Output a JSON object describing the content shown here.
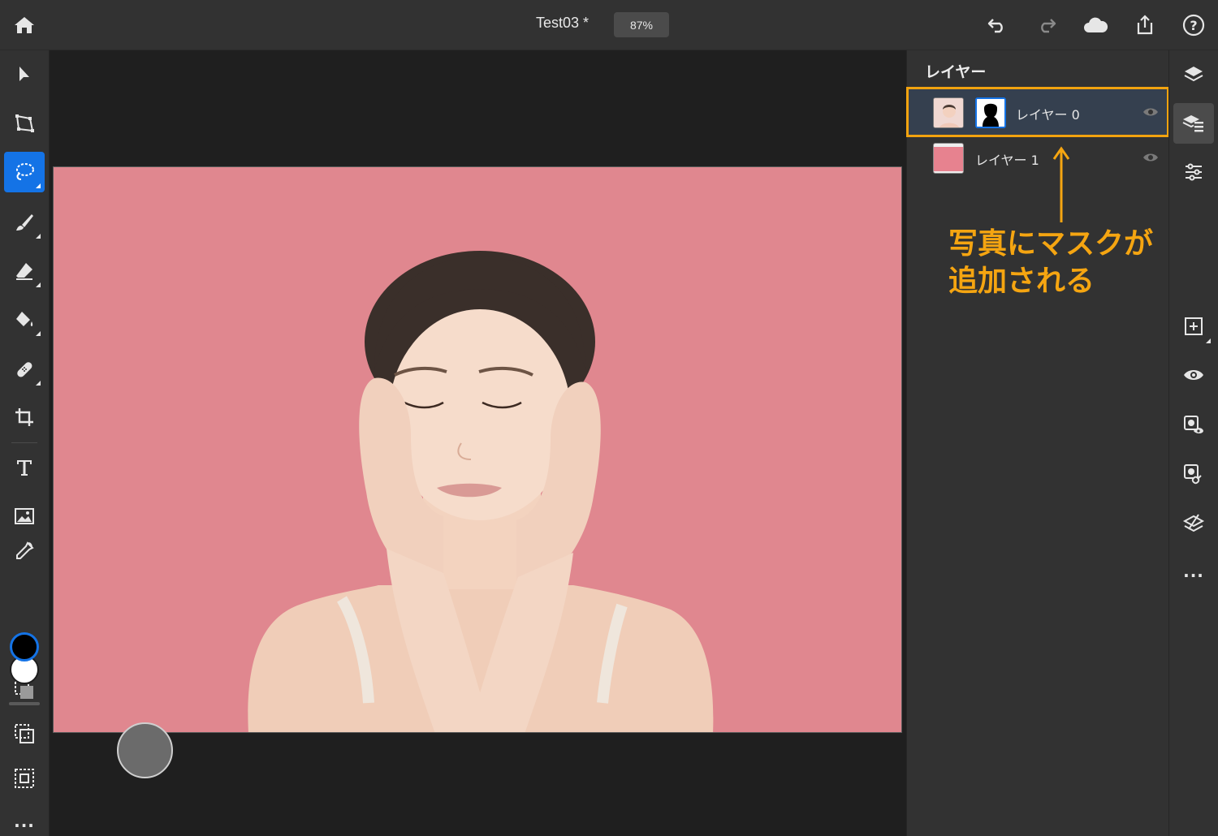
{
  "topbar": {
    "document_title": "Test03 *",
    "zoom": "87%",
    "left_icon": "home-icon",
    "right_icons": [
      "undo-icon",
      "redo-icon",
      "cloud-icon",
      "share-icon",
      "help-icon"
    ]
  },
  "left_toolbar": {
    "tools": [
      {
        "name": "select-tool",
        "icon": "arrow-pointer-icon"
      },
      {
        "name": "transform-tool",
        "icon": "transform-icon"
      },
      {
        "name": "lasso-tool",
        "icon": "lasso-icon",
        "active": true
      },
      {
        "name": "brush-tool",
        "icon": "brush-icon"
      },
      {
        "name": "eraser-tool",
        "icon": "eraser-icon"
      },
      {
        "name": "fill-tool",
        "icon": "paint-bucket-icon"
      },
      {
        "name": "healing-tool",
        "icon": "bandage-icon"
      },
      {
        "name": "crop-tool",
        "icon": "crop-icon"
      },
      {
        "name": "type-tool",
        "icon": "type-icon"
      },
      {
        "name": "place-image-tool",
        "icon": "image-icon"
      },
      {
        "name": "eyedropper-tool",
        "icon": "eyedropper-icon"
      }
    ],
    "foreground_color": "#000000",
    "background_color": "#ffffff",
    "selection_tools": [
      "select-subject-icon",
      "invert-selection-icon",
      "deselect-icon"
    ],
    "more": "..."
  },
  "canvas": {
    "background_color": "#e0878f",
    "content": "woman-portrait-image"
  },
  "layers_panel": {
    "title": "レイヤー",
    "layers": [
      {
        "name": "レイヤー 0",
        "has_mask": true,
        "selected": true
      },
      {
        "name": "レイヤー 1",
        "has_mask": false,
        "selected": false
      }
    ]
  },
  "annotation": {
    "line1": "写真にマスクが",
    "line2": "追加される",
    "color": "#f5a511"
  },
  "right_strip": {
    "tools": [
      "layers-icon",
      "layer-properties-icon",
      "adjustments-icon",
      "add-layer-icon",
      "visibility-icon",
      "mask-visibility-icon",
      "link-mask-icon",
      "clear-layer-icon"
    ],
    "more": "..."
  }
}
